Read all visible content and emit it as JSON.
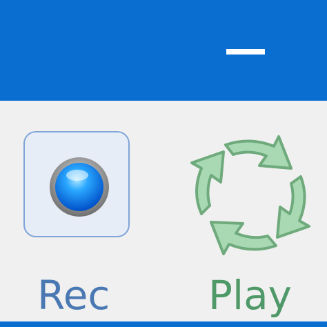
{
  "window": {
    "minimize_icon": "minimize-icon",
    "titlebar_color": "#0a6ed1"
  },
  "toolbar": {
    "rec": {
      "label": "Rec",
      "icon": "record-icon",
      "label_color": "#4a78b3"
    },
    "play": {
      "label": "Play",
      "icon": "refresh-cycle-icon",
      "label_color": "#4f9868"
    }
  }
}
